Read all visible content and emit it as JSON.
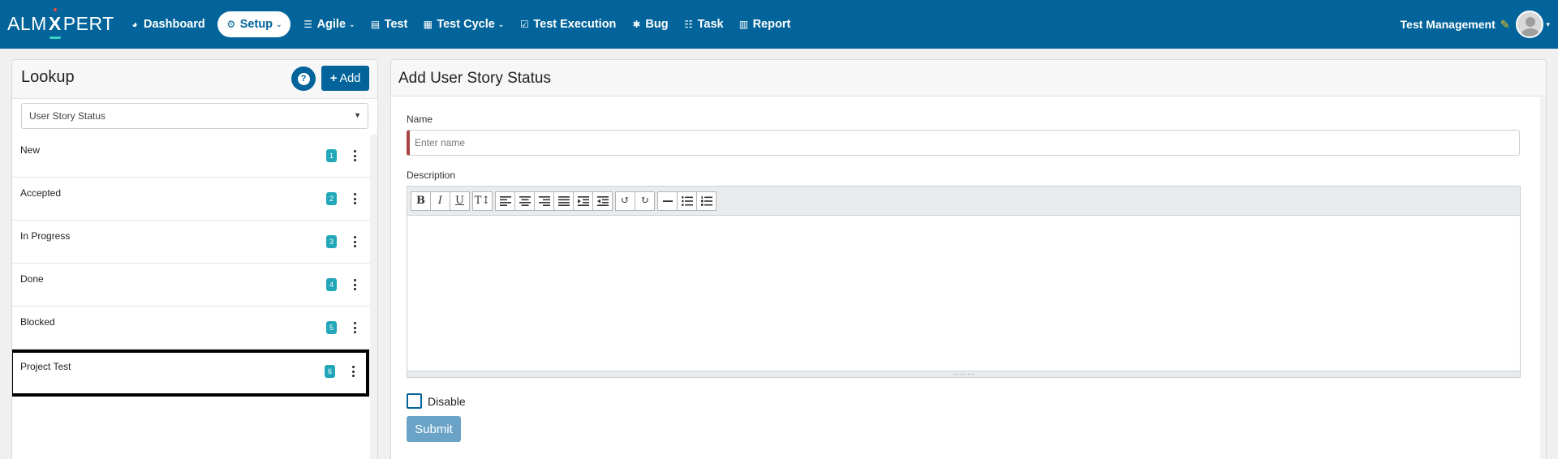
{
  "brand": {
    "logo_left": "ALM",
    "logo_x": "X",
    "logo_right": "PERT"
  },
  "nav": {
    "items": [
      {
        "label": "Dashboard",
        "icon": "dashboard-icon",
        "glyph": "◕"
      },
      {
        "label": "Setup",
        "icon": "gears-icon",
        "glyph": "⚙",
        "caret": "⌄",
        "active": true
      },
      {
        "label": "Agile",
        "icon": "list-icon",
        "glyph": "☰",
        "caret": "⌄"
      },
      {
        "label": "Test",
        "icon": "file-icon",
        "glyph": "▤"
      },
      {
        "label": "Test Cycle",
        "icon": "table-icon",
        "glyph": "▦",
        "caret": "⌄"
      },
      {
        "label": "Test Execution",
        "icon": "check-square-icon",
        "glyph": "☑"
      },
      {
        "label": "Bug",
        "icon": "bug-icon",
        "glyph": "✱"
      },
      {
        "label": "Task",
        "icon": "tasks-icon",
        "glyph": "☷"
      },
      {
        "label": "Report",
        "icon": "report-icon",
        "glyph": "▥"
      }
    ]
  },
  "user": {
    "name": "Test Management",
    "pencil_glyph": "✎",
    "caret": "▾"
  },
  "lookup": {
    "title": "Lookup",
    "help_glyph": "?",
    "add_plus": "+",
    "add_label": "Add",
    "selected_type": "User Story Status",
    "select_arrow": "▼",
    "items": [
      {
        "name": "New",
        "order": "1"
      },
      {
        "name": "Accepted",
        "order": "2"
      },
      {
        "name": "In Progress",
        "order": "3"
      },
      {
        "name": "Done",
        "order": "4"
      },
      {
        "name": "Blocked",
        "order": "5"
      },
      {
        "name": "Project Test",
        "order": "6",
        "selected": true
      }
    ]
  },
  "form": {
    "title": "Add User Story Status",
    "name_label": "Name",
    "name_placeholder": "Enter name",
    "name_value": "",
    "description_label": "Description",
    "toolbar": {
      "bold": "B",
      "italic": "I",
      "underline": "U",
      "font_size": "T↕",
      "undo": "↺",
      "redo": "↻"
    },
    "resize_grip": "⋯⋯⋯",
    "disable_label": "Disable",
    "disable_checked": false,
    "submit_label": "Submit"
  },
  "colors": {
    "nav_bg": "#02649a",
    "accent": "#02649a",
    "badge": "#22a7b8",
    "required_marker": "#a94442",
    "submit_disabled": "#6aa3c7"
  }
}
